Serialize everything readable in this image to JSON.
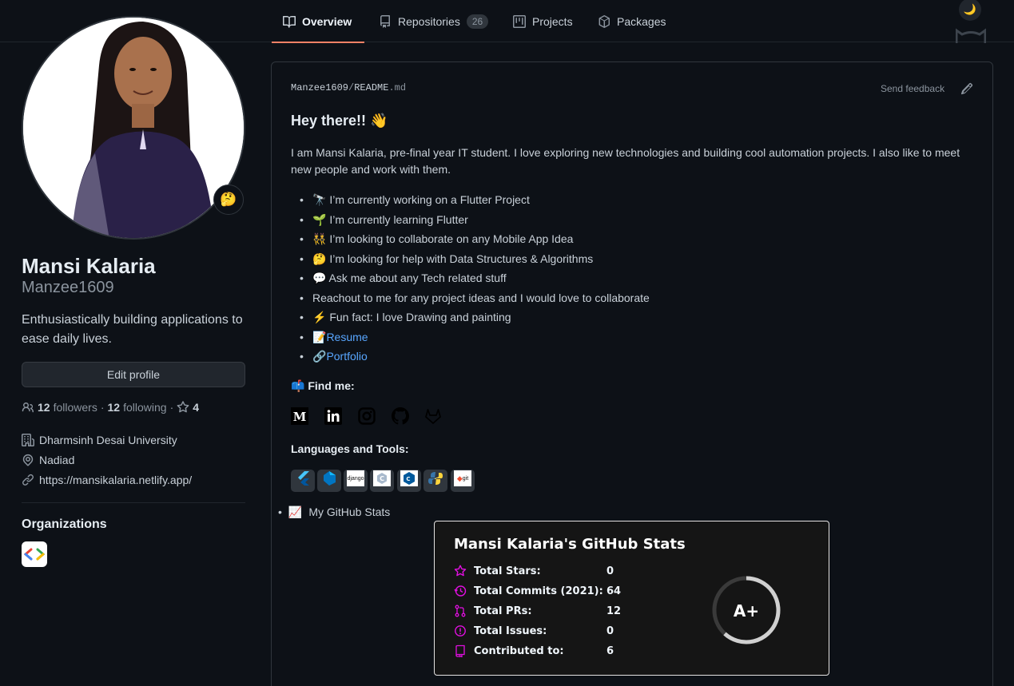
{
  "nav": {
    "tabs": [
      {
        "label": "Overview",
        "icon": "book-icon",
        "active": true
      },
      {
        "label": "Repositories",
        "icon": "repo-icon",
        "count": "26"
      },
      {
        "label": "Projects",
        "icon": "project-icon"
      },
      {
        "label": "Packages",
        "icon": "package-icon"
      }
    ]
  },
  "profile": {
    "name": "Mansi Kalaria",
    "username": "Manzee1609",
    "status_emoji": "🤔",
    "bio": "Enthusiastically building applications to ease daily lives.",
    "edit_button": "Edit profile",
    "followers_count": "12",
    "followers_label": "followers",
    "following_count": "12",
    "following_label": "following",
    "stars_count": "4",
    "organization": "Dharmsinh Desai University",
    "location": "Nadiad",
    "website": "https://mansikalaria.netlify.app/",
    "organizations_title": "Organizations"
  },
  "readme": {
    "path_owner": "Manzee1609",
    "path_sep": "/",
    "path_file": "README",
    "path_ext": ".md",
    "feedback": "Send feedback",
    "heading": "Hey there!! 👋",
    "intro": "I am Mansi Kalaria, pre-final year IT student. I love exploring new technologies and building cool automation projects. I also like to meet new people and work with them.",
    "bullets": [
      "🔭 I’m currently working on a Flutter Project",
      "🌱 I’m currently learning Flutter",
      "👯 I’m looking to collaborate on any Mobile App Idea",
      "🤔 I’m looking for help with Data Structures & Algorithms",
      "💬 Ask me about any Tech related stuff",
      "Reachout to me for any project ideas and I would love to collaborate",
      "⚡ Fun fact: I love Drawing and painting"
    ],
    "resume_prefix": "📝",
    "resume_label": "Resume",
    "portfolio_prefix": "🔗",
    "portfolio_label": "Portfolio",
    "find_me": "📫 Find me:",
    "languages_title": "Languages and Tools:",
    "tools": [
      "flutter",
      "dart",
      "django",
      "c",
      "cplusplus",
      "python",
      "git"
    ],
    "tool_labels": {
      "django": "django",
      "git": "git"
    },
    "stats_bullet_icon": "📈",
    "stats_bullet": "My GitHub Stats"
  },
  "stats": {
    "title": "Mansi Kalaria's GitHub Stats",
    "rows": [
      {
        "label": "Total Stars:",
        "value": "0",
        "icon": "star-icon"
      },
      {
        "label": "Total Commits (2021):",
        "value": "64",
        "icon": "history-icon"
      },
      {
        "label": "Total PRs:",
        "value": "12",
        "icon": "pull-request-icon"
      },
      {
        "label": "Total Issues:",
        "value": "0",
        "icon": "issue-icon"
      },
      {
        "label": "Contributed to:",
        "value": "6",
        "icon": "repo-icon"
      }
    ],
    "rank": "A+",
    "accent": "#e10fe0"
  },
  "theme": {
    "background": "#0d1117",
    "link": "#58a6ff",
    "tab_underline": "#f78166"
  }
}
